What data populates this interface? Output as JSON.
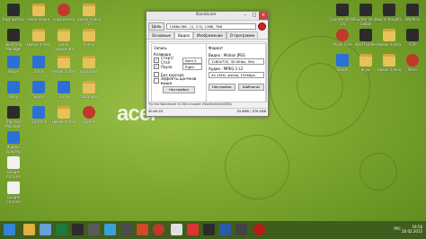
{
  "desktop": {
    "logo_text": "acer",
    "left_icons": [
      {
        "label": "Компьютер",
        "kind": "dark"
      },
      {
        "label": "Нова папка",
        "kind": "folder"
      },
      {
        "label": "корзиночка",
        "kind": "red"
      },
      {
        "label": "Новая папка (2)",
        "kind": "folder"
      },
      {
        "label": "SketchUp Manager",
        "kind": "dark"
      },
      {
        "label": "Новая папка",
        "kind": "folder"
      },
      {
        "label": "день рождения",
        "kind": "folder"
      },
      {
        "label": "папка",
        "kind": "folder"
      },
      {
        "label": "Skype",
        "kind": "app"
      },
      {
        "label": "Zona",
        "kind": "app"
      },
      {
        "label": "Новая папка",
        "kind": "folder"
      },
      {
        "label": "курсовая",
        "kind": "folder"
      },
      {
        "label": "eBay",
        "kind": "app"
      },
      {
        "label": "Skype",
        "kind": "app"
      },
      {
        "label": "Zona",
        "kind": "app"
      },
      {
        "label": "сюрпризы",
        "kind": "folder"
      },
      {
        "label": "Trap and Manager",
        "kind": "dark"
      },
      {
        "label": "µTorrent",
        "kind": "app"
      },
      {
        "label": "Новая папка",
        "kind": "folder"
      },
      {
        "label": "Opera",
        "kind": "red"
      },
      {
        "label": "Яндекс Браузер",
        "kind": "app"
      },
      {
        "label": "Google Chrome",
        "kind": "white"
      },
      {
        "label": "Google Chrome",
        "kind": "white"
      }
    ],
    "right_icons": [
      {
        "label": "Counter-Strike 1.6",
        "kind": "dark"
      },
      {
        "label": "Counter Strike Global",
        "kind": "dark"
      },
      {
        "label": "Spiral Knights",
        "kind": "dark"
      },
      {
        "label": "Warface",
        "kind": "dark"
      },
      {
        "label": "Avast Free",
        "kind": "red"
      },
      {
        "label": "WarThunder",
        "kind": "dark"
      },
      {
        "label": "Новая папка",
        "kind": "folder"
      },
      {
        "label": "GTA",
        "kind": "dark"
      },
      {
        "label": "Steam",
        "kind": "app"
      },
      {
        "label": "игры",
        "kind": "folder"
      },
      {
        "label": "Новая папка",
        "kind": "folder"
      },
      {
        "label": "Nero",
        "kind": "red"
      }
    ]
  },
  "bandicam": {
    "title": "Bandicam",
    "target_button": "Цель",
    "target_value": "1366x768 - (1, 2.5), 1366, 768",
    "tabs": [
      "Основные",
      "Видео",
      "Изображение",
      "О программе"
    ],
    "left_group_title": "Запись",
    "hotkey_label": "Клавиши",
    "start_stop_label": "Старт/Стоп",
    "start_stop_key": "Num 0",
    "pause_label": "Пауза",
    "pause_key": "Right",
    "no_cursor_label": "Без курсора",
    "mouse_effects_label": "Эффекты щелчков мыши",
    "settings_button_left": "Настройки",
    "right_group_title": "Формат",
    "video_label": "Видео : Motion JPEG",
    "video_value": "1280x720, 30.00fps, 50q",
    "audio_label": "Аудио : MPEG-1 L2",
    "audio_value": "44.1KHz, stereo, 192kbps",
    "settings_button_right": "Настройки",
    "templates_button": "Шаблоны",
    "status_text": "Try the Bandicam H.264 encoder (Nvidia/Intel/AMD)",
    "elapsed_time": "00:00:23",
    "file_size": "33.4MB / 379.0GB"
  },
  "taskbar": {
    "lang": "РУС",
    "time": "19:56",
    "date": "20.02.2015"
  }
}
